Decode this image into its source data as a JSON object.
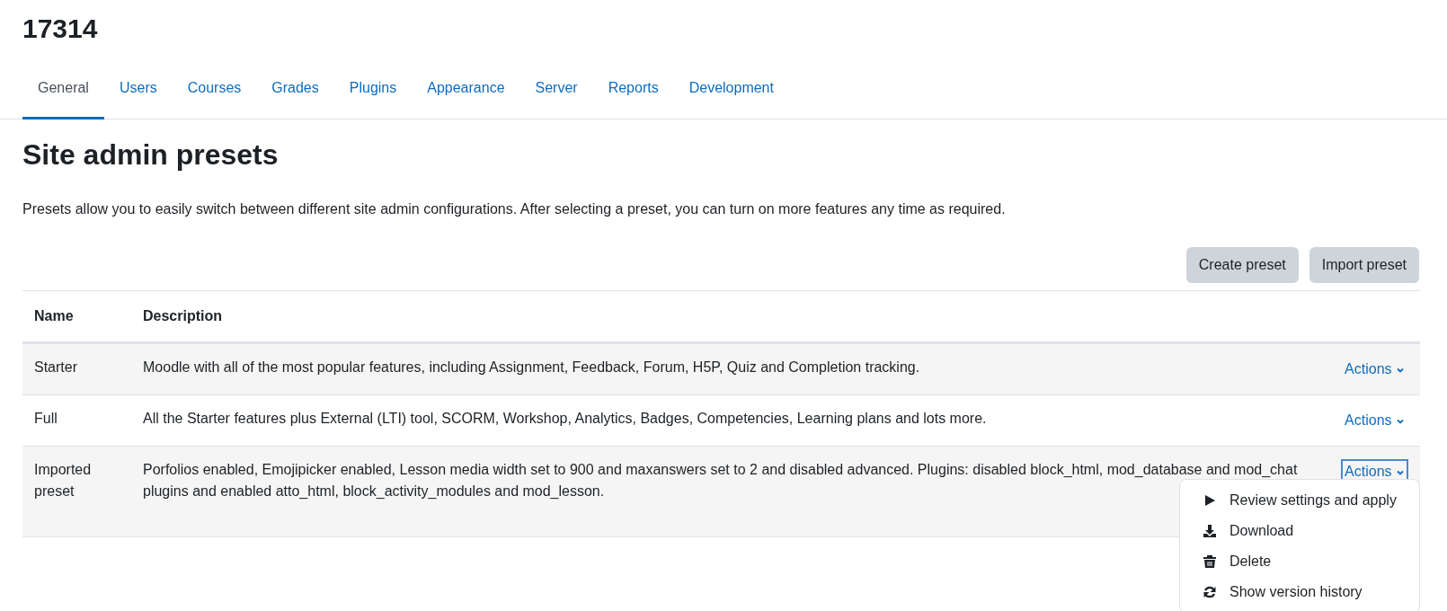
{
  "page_title": "17314",
  "tabs": [
    {
      "label": "General",
      "selected": true
    },
    {
      "label": "Users",
      "selected": false
    },
    {
      "label": "Courses",
      "selected": false
    },
    {
      "label": "Grades",
      "selected": false
    },
    {
      "label": "Plugins",
      "selected": false
    },
    {
      "label": "Appearance",
      "selected": false
    },
    {
      "label": "Server",
      "selected": false
    },
    {
      "label": "Reports",
      "selected": false
    },
    {
      "label": "Development",
      "selected": false
    }
  ],
  "heading": "Site admin presets",
  "intro": "Presets allow you to easily switch between different site admin configurations. After selecting a preset, you can turn on more features any time as required.",
  "buttons": [
    "Create preset",
    "Import preset"
  ],
  "table": {
    "columns": [
      "Name",
      "Description"
    ],
    "rows": [
      {
        "name": "Starter",
        "description": "Moodle with all of the most popular features, including Assignment, Feedback, Forum, H5P, Quiz and Completion tracking.",
        "actions": "Actions",
        "expanded": false
      },
      {
        "name": "Full",
        "description": "All the Starter features plus External (LTI) tool, SCORM, Workshop, Analytics, Badges, Competencies, Learning plans and lots more.",
        "actions": "Actions",
        "expanded": false
      },
      {
        "name": "Imported preset",
        "description": "Porfolios enabled, Emojipicker enabled, Lesson media width set to 900 and maxanswers set to 2 and disabled advanced. Plugins: disabled block_html, mod_database and mod_chat plugins and enabled atto_html, block_activity_modules and mod_lesson.",
        "actions": "Actions",
        "expanded": true
      }
    ]
  },
  "actions_menu": [
    {
      "kind": "play",
      "label": "Review settings and apply"
    },
    {
      "kind": "download",
      "label": "Download"
    },
    {
      "kind": "delete",
      "label": "Delete"
    },
    {
      "kind": "history",
      "label": "Show version history"
    }
  ]
}
